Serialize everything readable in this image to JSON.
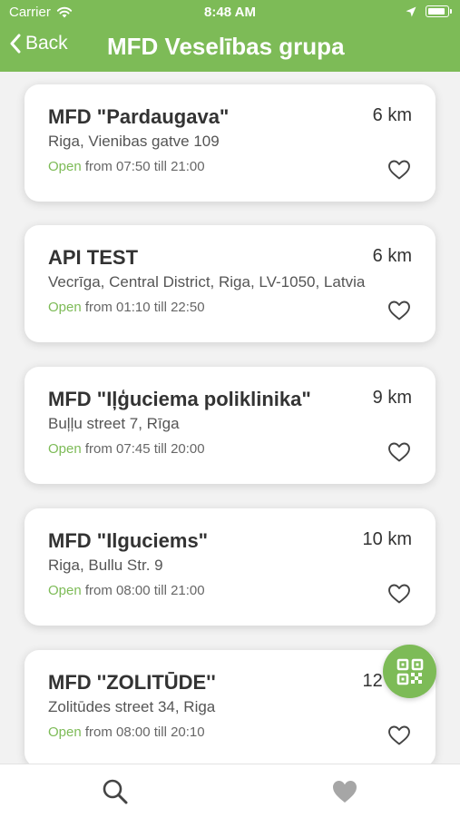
{
  "status_bar": {
    "carrier": "Carrier",
    "time": "8:48 AM"
  },
  "nav": {
    "back_label": "Back",
    "title": "MFD Veselības grupa"
  },
  "colors": {
    "brand_green": "#7dbb57",
    "open_green": "#7dbb57"
  },
  "clinics": [
    {
      "name": "MFD \"Pardaugava\"",
      "distance": "6 km",
      "address": "Riga, Vienibas gatve 109",
      "open_label": "Open",
      "hours": "from 07:50 till 21:00"
    },
    {
      "name": "API TEST",
      "distance": "6 km",
      "address": "Vecrīga, Central District, Riga, LV-1050, Latvia",
      "open_label": "Open",
      "hours": "from 01:10 till 22:50"
    },
    {
      "name": "MFD \"Iļģuciema poliklinika\"",
      "distance": "9 km",
      "address": "Buļļu street 7, Rīga",
      "open_label": "Open",
      "hours": "from 07:45 till 20:00"
    },
    {
      "name": "MFD \"Ilguciems\"",
      "distance": "10 km",
      "address": "Riga, Bullu Str. 9",
      "open_label": "Open",
      "hours": "from 08:00 till 21:00"
    },
    {
      "name": "MFD ''ZOLITŪDE''",
      "distance": "12 km",
      "address": "Zolitūdes street 34, Riga",
      "open_label": "Open",
      "hours": "from 08:00 till 20:10"
    }
  ],
  "icons": {
    "qr": "qr-code-icon",
    "search_tab": "search-icon",
    "favorites_tab": "heart-icon"
  }
}
